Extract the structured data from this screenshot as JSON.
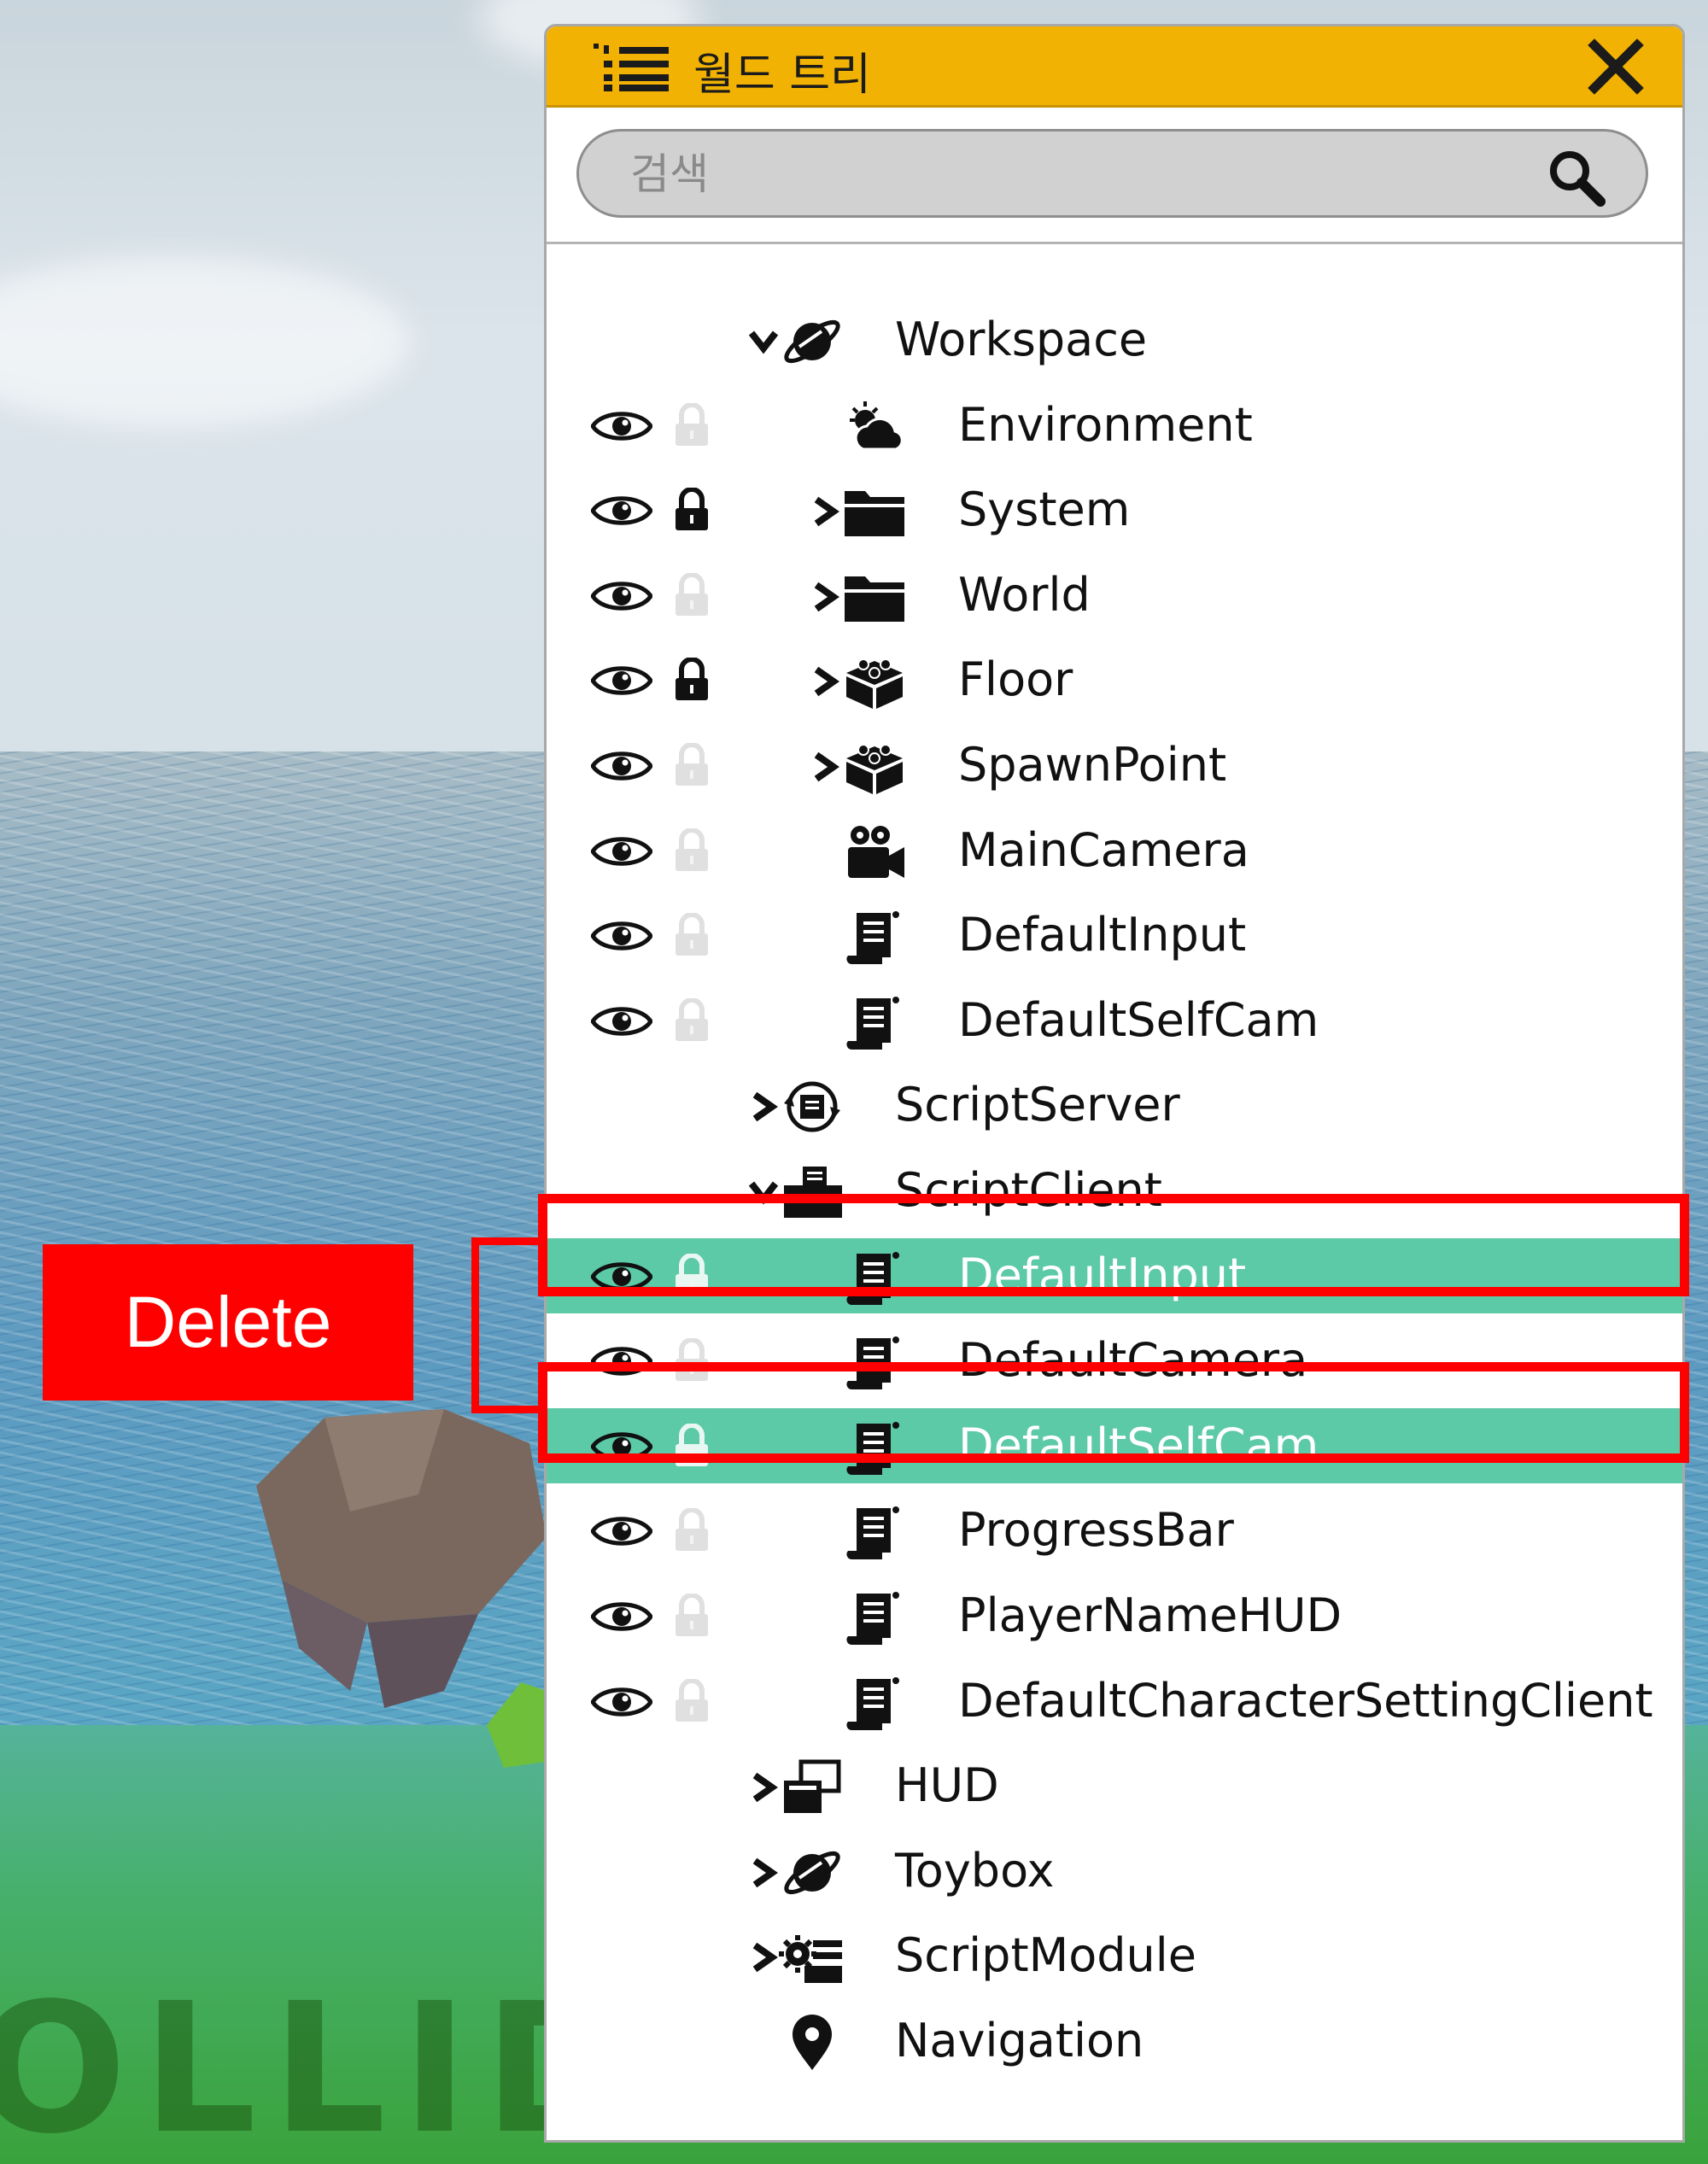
{
  "window": {
    "title": "월드 트리",
    "title_icon": "list-tree-icon",
    "close_icon": "close-icon",
    "header_color": "#f2b203"
  },
  "search": {
    "placeholder": "검색",
    "value": "",
    "icon": "search-icon"
  },
  "tree": {
    "rows": [
      {
        "label": "Workspace",
        "icon": "planet-icon",
        "expand": "expanded",
        "visibility": false,
        "lock": "none",
        "highlighted": false
      },
      {
        "label": "Environment",
        "icon": "weather-icon",
        "expand": "none",
        "visibility": true,
        "lock": "unlocked",
        "highlighted": false
      },
      {
        "label": "System",
        "icon": "folder-icon",
        "expand": "collapsed",
        "visibility": true,
        "lock": "locked",
        "highlighted": false
      },
      {
        "label": "World",
        "icon": "folder-icon",
        "expand": "collapsed",
        "visibility": true,
        "lock": "unlocked",
        "highlighted": false
      },
      {
        "label": "Floor",
        "icon": "block-icon",
        "expand": "collapsed",
        "visibility": true,
        "lock": "locked",
        "highlighted": false
      },
      {
        "label": "SpawnPoint",
        "icon": "block-icon",
        "expand": "collapsed",
        "visibility": true,
        "lock": "unlocked",
        "highlighted": false
      },
      {
        "label": "MainCamera",
        "icon": "camera-icon",
        "expand": "none",
        "visibility": true,
        "lock": "unlocked",
        "highlighted": false
      },
      {
        "label": "DefaultInput",
        "icon": "script-icon",
        "expand": "none",
        "visibility": true,
        "lock": "unlocked",
        "highlighted": false
      },
      {
        "label": "DefaultSelfCam",
        "icon": "script-icon",
        "expand": "none",
        "visibility": true,
        "lock": "unlocked",
        "highlighted": false
      },
      {
        "label": "ScriptServer",
        "icon": "script-server-icon",
        "expand": "collapsed",
        "visibility": false,
        "lock": "none",
        "highlighted": false
      },
      {
        "label": "ScriptClient",
        "icon": "script-client-icon",
        "expand": "expanded",
        "visibility": false,
        "lock": "none",
        "highlighted": false
      },
      {
        "label": "DefaultInput",
        "icon": "script-icon",
        "expand": "none",
        "visibility": true,
        "lock": "unlocked",
        "highlighted": true
      },
      {
        "label": "DefaultCamera",
        "icon": "script-icon",
        "expand": "none",
        "visibility": true,
        "lock": "unlocked",
        "highlighted": false
      },
      {
        "label": "DefaultSelfCam",
        "icon": "script-icon",
        "expand": "none",
        "visibility": true,
        "lock": "unlocked",
        "highlighted": true
      },
      {
        "label": "ProgressBar",
        "icon": "script-icon",
        "expand": "none",
        "visibility": true,
        "lock": "unlocked",
        "highlighted": false
      },
      {
        "label": "PlayerNameHUD",
        "icon": "script-icon",
        "expand": "none",
        "visibility": true,
        "lock": "unlocked",
        "highlighted": false
      },
      {
        "label": "DefaultCharacterSettingClient",
        "icon": "script-icon",
        "expand": "none",
        "visibility": true,
        "lock": "unlocked",
        "highlighted": false
      },
      {
        "label": "HUD",
        "icon": "hud-icon",
        "expand": "collapsed",
        "visibility": false,
        "lock": "none",
        "highlighted": false
      },
      {
        "label": "Toybox",
        "icon": "planet-icon",
        "expand": "collapsed",
        "visibility": false,
        "lock": "none",
        "highlighted": false
      },
      {
        "label": "ScriptModule",
        "icon": "script-module-icon",
        "expand": "collapsed",
        "visibility": false,
        "lock": "none",
        "highlighted": false
      },
      {
        "label": "Navigation",
        "icon": "map-pin-icon",
        "expand": "none",
        "visibility": false,
        "lock": "none",
        "highlighted": false
      }
    ],
    "highlight_color": "#5cc9a7"
  },
  "annotation": {
    "delete_label": "Delete",
    "color": "#ff0000"
  },
  "background": {
    "watermark_text": "OLLID"
  }
}
